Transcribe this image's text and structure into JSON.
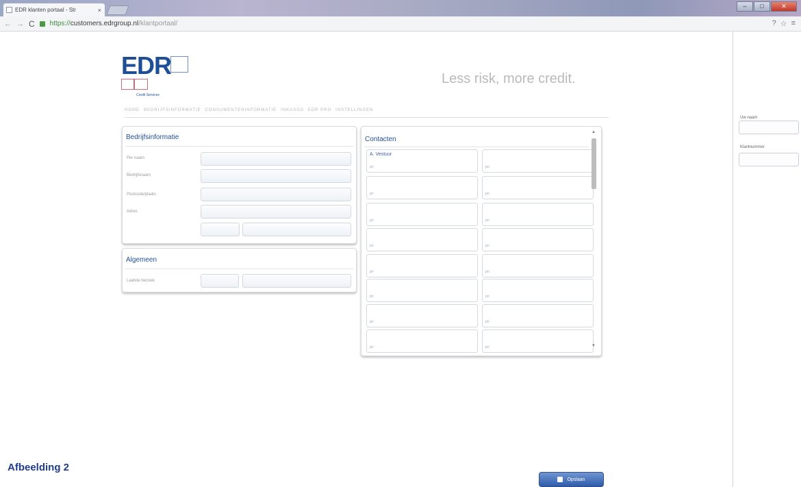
{
  "browser": {
    "tab_title": "EDR klanten portaal - Str",
    "tab_close": "×",
    "minimize": "–",
    "maximize": "□",
    "close": "✕",
    "url_protocol": "https://",
    "url_host": "customers.edrgroup.nl",
    "url_path": "/klantportaal/",
    "back": "←",
    "forward": "→",
    "reload": "C",
    "toolbar_icons": [
      "?",
      "☆",
      "≡"
    ]
  },
  "header": {
    "logo_text": "EDR",
    "logo_sub": "Credit Services",
    "tagline": "Less risk, more credit."
  },
  "menu": [
    "HOME",
    "BEDRIJFSINFORMATIE",
    "CONSUMENTENINFORMATIE",
    "INKASSO",
    "EDR PRO",
    "INSTELLINGEN"
  ],
  "company_panel": {
    "title": "Bedrijfsinformatie",
    "fields": [
      "Per naam",
      "Bedrijfsnaam",
      "Postcode/plaats",
      "Adres"
    ]
  },
  "general_panel": {
    "title": "Algemeen",
    "fields": [
      "Laatste bezoek"
    ]
  },
  "contacts_panel": {
    "title": "Contacten",
    "first_contact_name": "A. Vestuur",
    "cell_note": "pri"
  },
  "side_panel": {
    "labels": [
      "Uw naam",
      "Klantnummer"
    ]
  },
  "footer": {
    "caption": "Afbeelding 2",
    "save_label": "Opslaan"
  }
}
